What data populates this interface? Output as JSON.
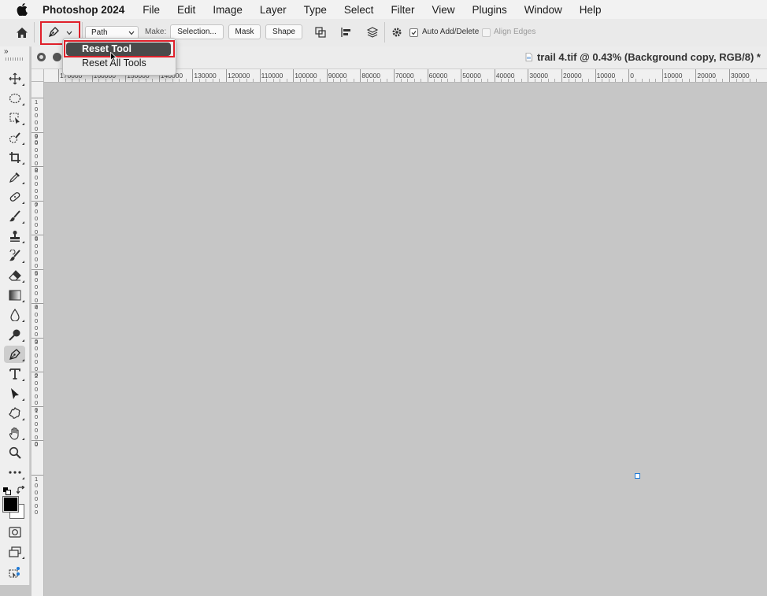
{
  "menubar": {
    "apple_icon": "apple-logo-icon",
    "app_name": "Photoshop 2024",
    "items": [
      "File",
      "Edit",
      "Image",
      "Layer",
      "Type",
      "Select",
      "Filter",
      "View",
      "Plugins",
      "Window",
      "Help"
    ]
  },
  "options_bar": {
    "mode_value": "Path",
    "make_label": "Make:",
    "selection_button": "Selection...",
    "mask_button": "Mask",
    "shape_button": "Shape",
    "auto_add_delete_label": "Auto Add/Delete",
    "auto_add_delete_checked": true,
    "align_edges_label": "Align Edges",
    "align_edges_checked": false
  },
  "dropdown_menu": {
    "items": [
      "Reset Tool",
      "Reset All Tools"
    ],
    "highlighted": "Reset Tool"
  },
  "document": {
    "title": "trail 4.tif @ 0.43% (Background copy, RGB/8) *"
  },
  "rulers": {
    "horizontal_labels": [
      "170000",
      "160000",
      "150000",
      "140000",
      "130000",
      "120000",
      "110000",
      "100000",
      "90000",
      "80000",
      "70000",
      "60000",
      "50000",
      "40000",
      "30000",
      "20000",
      "10000",
      "0",
      "10000",
      "20000",
      "30000"
    ],
    "vertical_labels": [
      "1000000",
      "900000",
      "800000",
      "700000",
      "600000",
      "500000",
      "400000",
      "300000",
      "200000",
      "100000",
      "0",
      "100000"
    ]
  },
  "toolbar": {
    "tools": [
      "move-tool",
      "elliptical-marquee-tool",
      "object-selection-tool",
      "quick-selection-tool",
      "crop-tool",
      "eyedropper-tool",
      "spot-healing-brush-tool",
      "brush-tool",
      "clone-stamp-tool",
      "history-brush-tool",
      "eraser-tool",
      "gradient-tool",
      "blur-tool",
      "dodge-tool",
      "pen-tool",
      "type-tool",
      "path-selection-tool",
      "custom-shape-tool",
      "hand-tool",
      "zoom-tool",
      "edit-toolbar"
    ],
    "active_tool": "pen-tool",
    "foreground_color": "#000000",
    "background_color": "#ffffff"
  },
  "colors": {
    "highlight_red": "#e0202a",
    "canvas_gray": "#c6c6c6",
    "anchor_blue": "#1e7ad6"
  }
}
